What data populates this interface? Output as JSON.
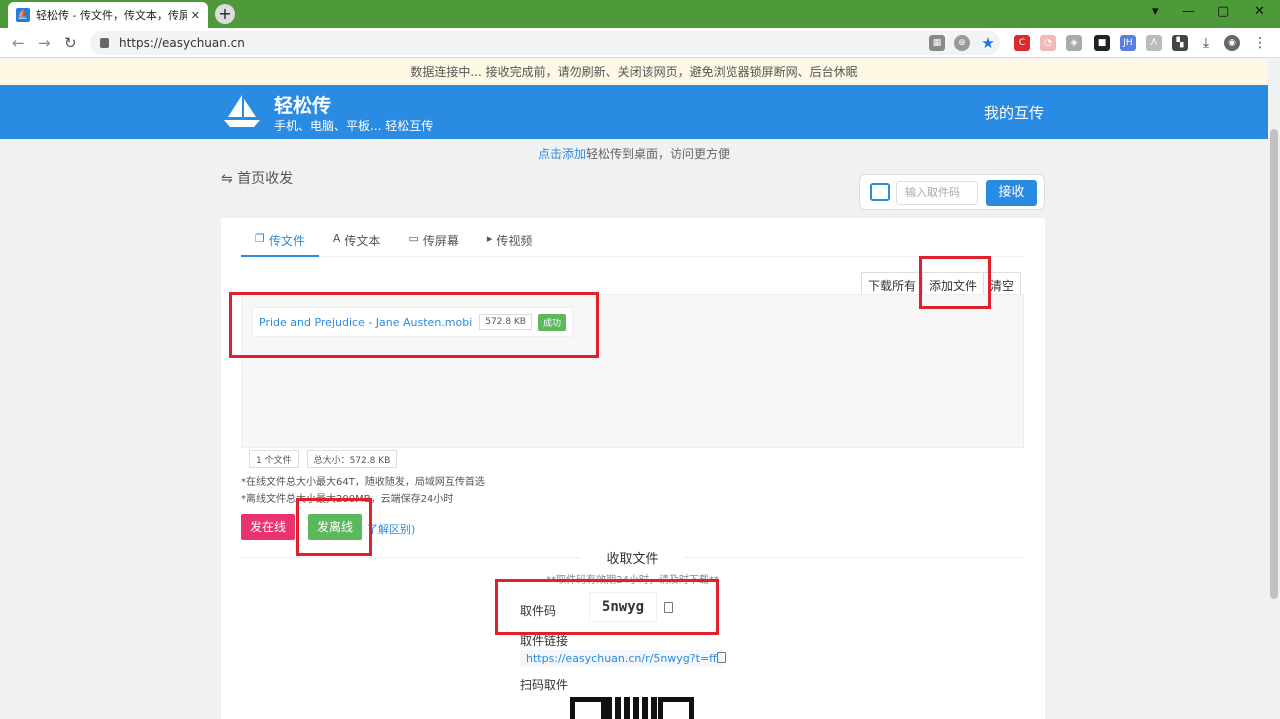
{
  "browser": {
    "tab_title": "轻松传 - 传文件，传文本，传屏幕",
    "url": "https://easychuan.cn"
  },
  "notice": "数据连接中... 接收完成前，请勿刷新、关闭该网页，避免浏览器锁屏断网、后台休眠",
  "header": {
    "brand": "轻松传",
    "subtitle": "手机、电脑、平板... 轻松互传",
    "my_link": "我的互传"
  },
  "add_hint": {
    "link": "点击添加",
    "text": "轻松传到桌面，访问更方便"
  },
  "home_title": "⇋ 首页收发",
  "receive": {
    "placeholder": "输入取件码",
    "button": "接收"
  },
  "tabs": [
    {
      "label": "传文件",
      "icon": "file-icon"
    },
    {
      "label": "传文本",
      "icon": "text-icon"
    },
    {
      "label": "传屏幕",
      "icon": "screen-icon"
    },
    {
      "label": "传视频",
      "icon": "video-icon"
    }
  ],
  "toolbar": {
    "download_all": "下载所有",
    "add_file": "添加文件",
    "clear": "清空"
  },
  "file": {
    "name": "Pride and Prejudice - Jane Austen.mobi",
    "size": "572.8 KB",
    "status": "成功"
  },
  "file_footer": {
    "count": "1 个文件",
    "total": "总大小：572.8 KB"
  },
  "notes": {
    "line1": "*在线文件总大小最大64T，随收随发，局域网互传首选",
    "line2": "*离线文件总大小最大200MB，云端保存24小时"
  },
  "buttons": {
    "send_online": "发在线",
    "send_offline": "发离线",
    "diff": "了解区别)"
  },
  "pickup": {
    "title": "收取文件",
    "tip": "**取件码有效期24小时，请及时下载**",
    "code_label": "取件码",
    "code": "5nwyg",
    "link_label": "取件链接",
    "link": "https://easychuan.cn/r/5nwyg?t=ff",
    "qr_label": "扫码取件"
  },
  "colors": {
    "brand_blue": "#2a8be2",
    "success_green": "#5cb85c",
    "online_pink": "#e8336e",
    "annotation_red": "#e0202a"
  }
}
